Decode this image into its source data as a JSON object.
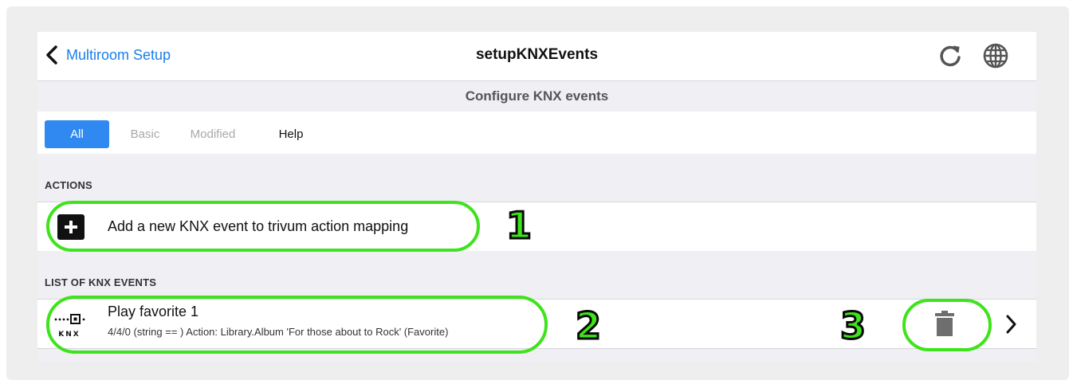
{
  "nav": {
    "back_label": "Multiroom Setup",
    "title": "setupKNXEvents",
    "refresh_icon": "refresh-icon",
    "globe_icon": "globe-icon"
  },
  "section_header": "Configure KNX events",
  "tabs": [
    {
      "label": "All",
      "state": "active"
    },
    {
      "label": "Basic",
      "state": "dim"
    },
    {
      "label": "Modified",
      "state": "dim"
    },
    {
      "label": "Help",
      "state": "normal"
    }
  ],
  "actions": {
    "heading": "ACTIONS",
    "add_label": "Add a new KNX event to trivum action mapping"
  },
  "events": {
    "heading": "LIST OF KNX EVENTS",
    "items": [
      {
        "title": "Play favorite 1",
        "detail": "4/4/0 (string == ) Action: Library.Album 'For those about to Rock' (Favorite)",
        "logo_text": "KNX"
      }
    ]
  },
  "annotations": [
    "1",
    "2",
    "3"
  ],
  "colors": {
    "accent": "#1a7fe8",
    "tab_active": "#2f89f0",
    "annotation": "#3ee31c"
  }
}
